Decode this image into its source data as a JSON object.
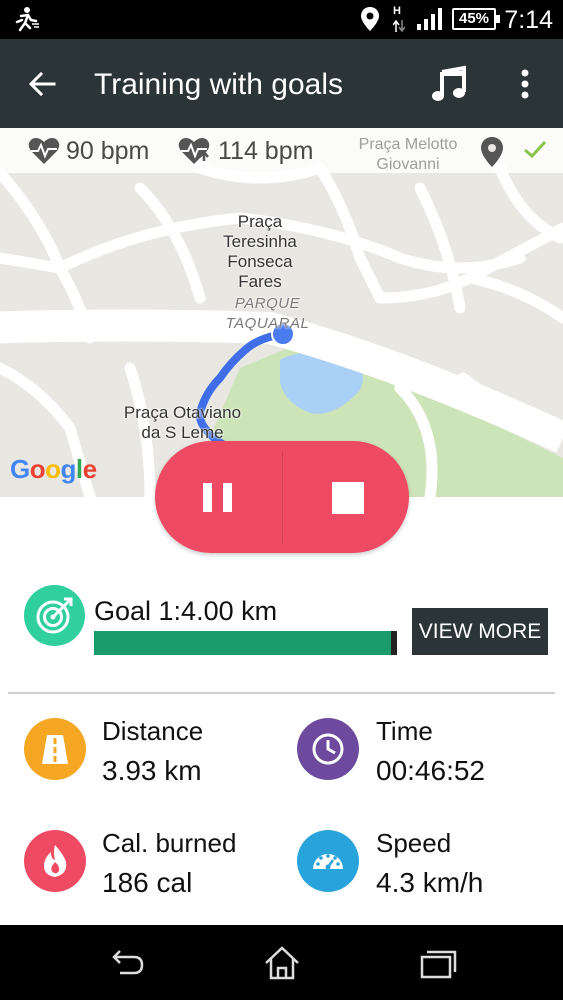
{
  "status_bar": {
    "network_type": "H",
    "battery": "45%",
    "time": "7:14"
  },
  "app_bar": {
    "title": "Training with goals"
  },
  "map": {
    "heart_rate_current": "90 bpm",
    "heart_rate_max": "114 bpm",
    "current_place_line1": "Praça Melotto",
    "current_place_line2": "Giovanni",
    "labels": {
      "praca_teresinha_1": "Praça",
      "praca_teresinha_2": "Teresinha",
      "praca_teresinha_3": "Fonseca Fares",
      "parque_1": "PARQUE",
      "parque_2": "TAQUARAL",
      "praca_otaviano_1": "Praça Otaviano",
      "praca_otaviano_2": "da S Leme"
    },
    "google": [
      "G",
      "o",
      "o",
      "g",
      "l",
      "e"
    ]
  },
  "goal": {
    "label": "Goal 1:4.00 km",
    "progress": 0.98,
    "view_more": "VIEW MORE"
  },
  "stats": {
    "distance": {
      "label": "Distance",
      "value": "3.93 km"
    },
    "time": {
      "label": "Time",
      "value": "00:46:52"
    },
    "calories": {
      "label": "Cal. burned",
      "value": "186 cal"
    },
    "speed": {
      "label": "Speed",
      "value": "4.3 km/h"
    }
  },
  "colors": {
    "app_bar": "#2b3437",
    "controls": "#ef4a63",
    "goal_icon": "#2fcf9e",
    "goal_fill": "#1a9b6c",
    "distance_icon": "#f5a623",
    "time_icon": "#6e4a9e",
    "calories_icon": "#ef4a63",
    "speed_icon": "#29a3dc",
    "route": "#3f6ee8"
  }
}
